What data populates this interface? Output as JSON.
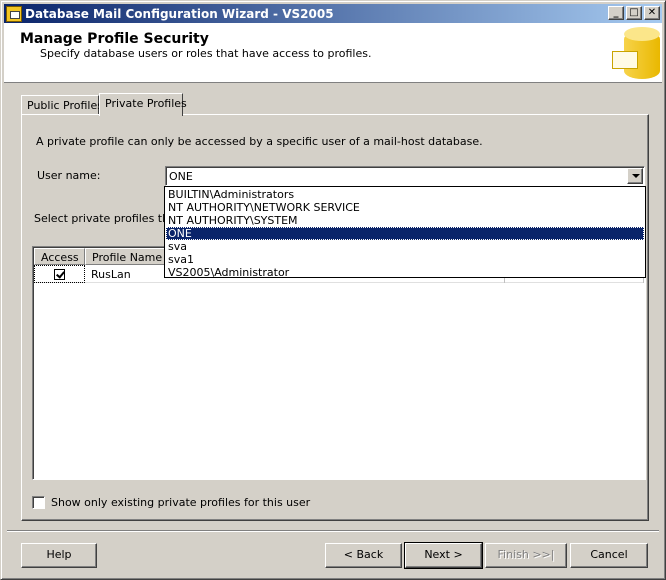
{
  "window": {
    "title": "Database Mail Configuration Wizard - VS2005",
    "minimize_glyph": "_",
    "maximize_glyph": "□",
    "close_glyph": "✕"
  },
  "header": {
    "title": "Manage Profile Security",
    "subtitle": "Specify database users or roles that have access to profiles."
  },
  "tabs": [
    {
      "label": "Public Profiles",
      "active": false
    },
    {
      "label": "Private Profiles",
      "active": true
    }
  ],
  "private_tab": {
    "description": "A private profile can only be accessed by a specific user of a mail-host database.",
    "user_name_label": "User name:",
    "user_name_value": "ONE",
    "select_label": "Select private profiles that c",
    "grid": {
      "columns": [
        "Access",
        "Profile Name",
        ""
      ],
      "rows": [
        {
          "access": true,
          "profile_name": "RusLan",
          "default": ""
        }
      ]
    },
    "show_only_label": "Show only existing private profiles for this user",
    "show_only_checked": false
  },
  "dropdown": {
    "items": [
      "BUILTIN\\Administrators",
      "NT AUTHORITY\\NETWORK SERVICE",
      "NT AUTHORITY\\SYSTEM",
      "ONE",
      "sva",
      "sva1",
      "VS2005\\Administrator"
    ],
    "selected": "ONE"
  },
  "buttons": {
    "help": "Help",
    "back": "< Back",
    "next": "Next >",
    "finish": "Finish >>|",
    "cancel": "Cancel"
  }
}
